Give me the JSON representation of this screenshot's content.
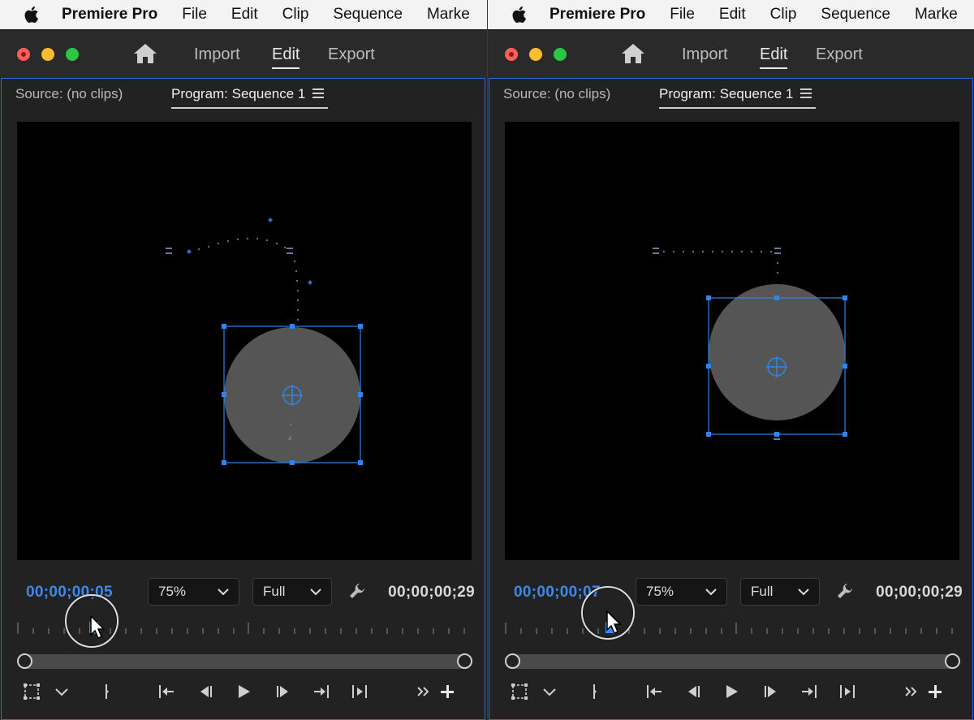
{
  "menubar": {
    "app_name": "Premiere Pro",
    "items": [
      "File",
      "Edit",
      "Clip",
      "Sequence",
      "Marke"
    ]
  },
  "workspace_nav": {
    "import_label": "Import",
    "edit_label": "Edit",
    "export_label": "Export",
    "active": "Edit"
  },
  "panes": [
    {
      "source_tab": "Source: (no clips)",
      "program_tab": "Program: Sequence 1",
      "current_timecode": "00;00;00;05",
      "zoom_value": "75%",
      "resolution_value": "Full",
      "duration_timecode": "00;00;00;29"
    },
    {
      "source_tab": "Source: (no clips)",
      "program_tab": "Program: Sequence 1",
      "current_timecode": "00;00;00;07",
      "zoom_value": "75%",
      "resolution_value": "Full",
      "duration_timecode": "00;00;00;29"
    }
  ],
  "colors": {
    "accent": "#2d6bd6",
    "timecode": "#3e88e6",
    "circle_fill": "#555555",
    "bounding_box": "#2f86e8"
  },
  "icons": {
    "apple": "apple-icon",
    "home": "home-icon",
    "panel_menu": "hamburger-menu-icon",
    "settings": "wrench-icon",
    "transport": [
      "safe-margins-icon",
      "chevron-down-icon",
      "add-marker-icon",
      "go-to-in-icon",
      "step-back-icon",
      "play-icon",
      "step-forward-icon",
      "go-to-out-icon",
      "play-in-to-out-icon",
      "more-icon",
      "add-button-icon"
    ]
  }
}
